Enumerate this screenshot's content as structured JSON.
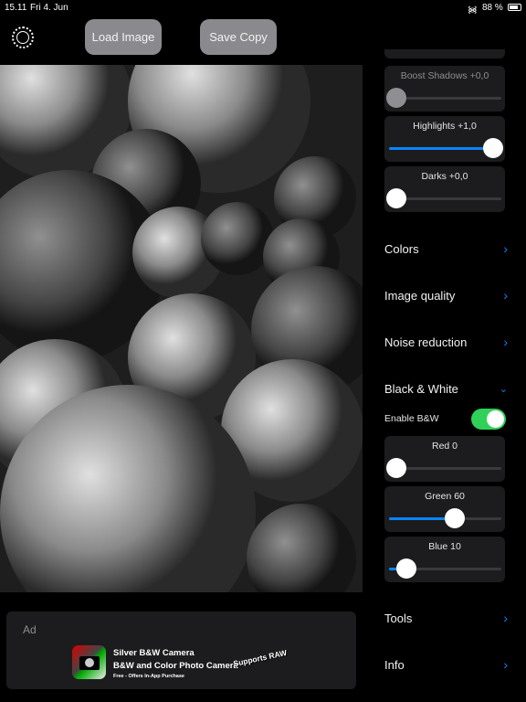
{
  "status": {
    "time": "15.11",
    "date": "Fri 4. Jun",
    "battery": "88 %"
  },
  "toolbar": {
    "load": "Load Image",
    "save": "Save Copy"
  },
  "sliders": [
    {
      "label": "Boost Shadows +0,0",
      "value": 0,
      "disabled": true
    },
    {
      "label": "Highlights +1,0",
      "value": 1.0
    },
    {
      "label": "Darks +0,0",
      "value": 0
    }
  ],
  "sections": {
    "colors": "Colors",
    "quality": "Image quality",
    "noise": "Noise reduction",
    "bw": "Black & White",
    "tools": "Tools",
    "info": "Info"
  },
  "bw": {
    "enable_label": "Enable B&W",
    "enabled": true,
    "channels": [
      {
        "label": "Red 0",
        "value": 0
      },
      {
        "label": "Green 60",
        "value": 60
      },
      {
        "label": "Blue 10",
        "value": 10
      }
    ]
  },
  "ad": {
    "label": "Ad",
    "title": "Silver B&W Camera",
    "subtitle": "B&W and Color Photo Camera",
    "note": "Free - Offers In-App Purchase",
    "badge": "Supports RAW"
  },
  "colors": {
    "accent": "#0a84ff",
    "toggle": "#30d158"
  }
}
